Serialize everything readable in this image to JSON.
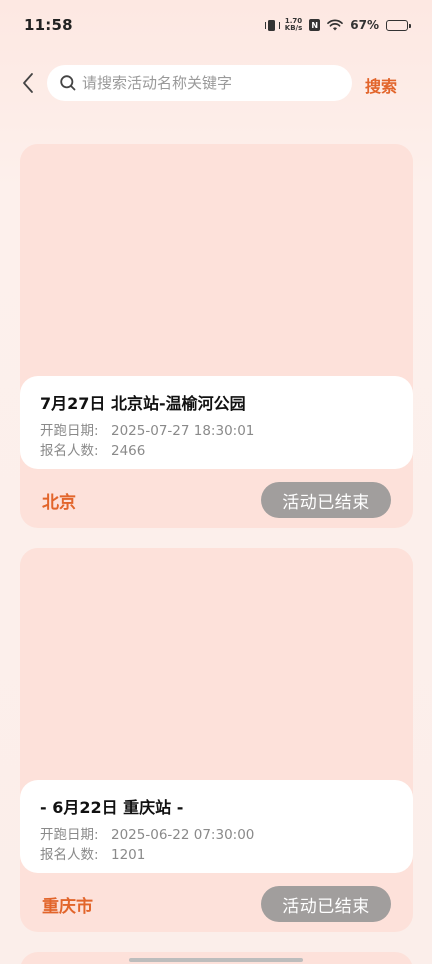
{
  "status_bar": {
    "time": "11:58",
    "net_speed_value": "1.70",
    "net_speed_unit": "KB/s",
    "nfc": "N",
    "battery": "67%",
    "battery_level": 0.67
  },
  "header": {
    "search_placeholder": "请搜索活动名称关键字",
    "search_button": "搜索"
  },
  "activities": [
    {
      "title": "7月27日 北京站-温榆河公园",
      "date_label": "开跑日期:",
      "date_value": "2025-07-27 18:30:01",
      "count_label": "报名人数:",
      "count_value": "2466",
      "city": "北京",
      "status": "活动已结束"
    },
    {
      "title": "- 6月22日 重庆站 -",
      "date_label": "开跑日期:",
      "date_value": "2025-06-22 07:30:00",
      "count_label": "报名人数:",
      "count_value": "1201",
      "city": "重庆市",
      "status": "活动已结束"
    }
  ],
  "colors": {
    "accent": "#e2652b",
    "card_bg": "#fde1da",
    "status_pill": "#a19e9d"
  }
}
